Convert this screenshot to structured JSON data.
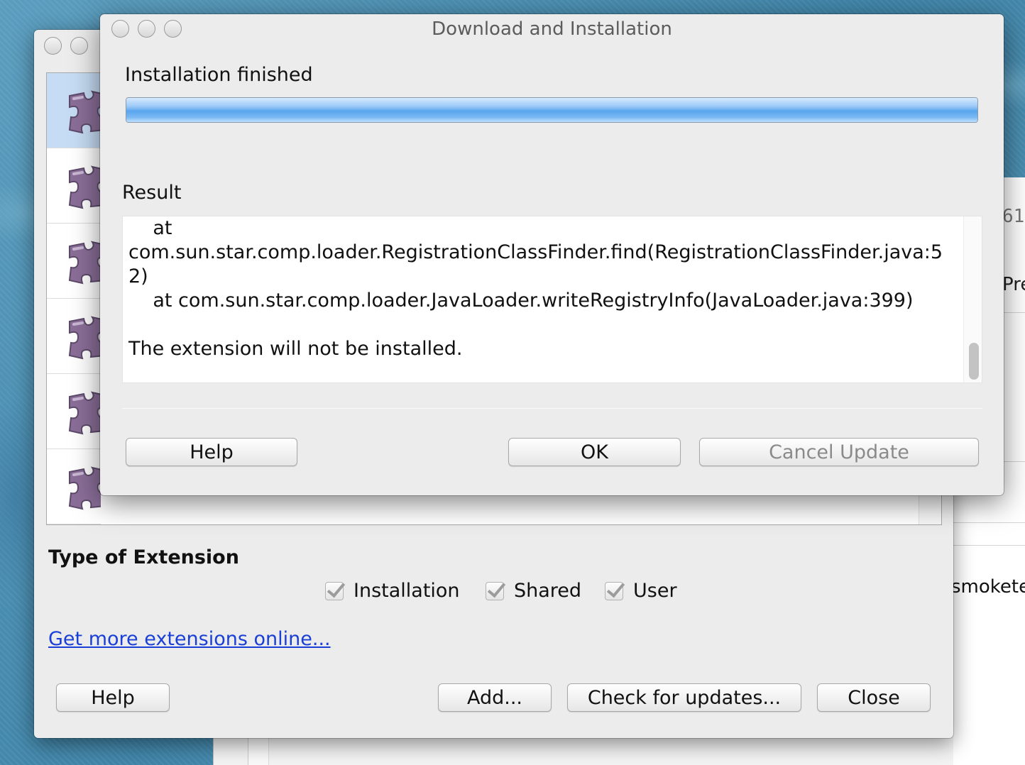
{
  "background_window": {
    "fragment_number": "61",
    "fragment_pre": "Pre",
    "fragment_smoke": "smokete"
  },
  "extension_manager": {
    "type_title": "Type of Extension",
    "filters": [
      {
        "label": "Installation",
        "checked": true
      },
      {
        "label": "Shared",
        "checked": true
      },
      {
        "label": "User",
        "checked": true
      }
    ],
    "get_more_link": "Get more extensions online...",
    "buttons": {
      "help": "Help",
      "add": "Add...",
      "check_updates": "Check for updates...",
      "close": "Close"
    },
    "rows": 6,
    "selected_row": 0,
    "icon": "puzzle-piece-icon",
    "icon_color": "#8a6e98"
  },
  "dialog": {
    "title": "Download and Installation",
    "status": "Installation finished",
    "progress_percent": 100,
    "result_label": "Result",
    "result_text": "    at\ncom.sun.star.comp.loader.RegistrationClassFinder.find(RegistrationClassFinder.java:52)\n    at com.sun.star.comp.loader.JavaLoader.writeRegistryInfo(JavaLoader.java:399)\n\nThe extension will not be installed.",
    "buttons": {
      "help": "Help",
      "ok": "OK",
      "cancel_update": "Cancel Update"
    },
    "progress_color": "#5aa5ee"
  }
}
